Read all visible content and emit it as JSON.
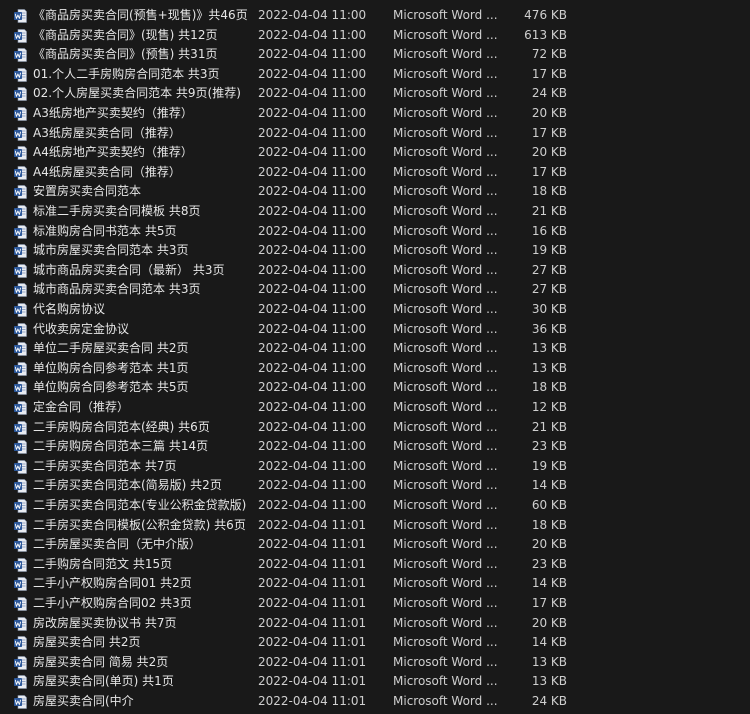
{
  "colors": {
    "background": "#191919",
    "text": "#dedede",
    "word_icon_blue": "#2b579a"
  },
  "icon": "word-document-icon",
  "files": [
    {
      "name": "《商品房买卖合同(预售+现售)》共46页",
      "modified": "2022-04-04 11:00",
      "type": "Microsoft Word ...",
      "size": "476 KB"
    },
    {
      "name": "《商品房买卖合同》(现售) 共12页",
      "modified": "2022-04-04 11:00",
      "type": "Microsoft Word ...",
      "size": "613 KB"
    },
    {
      "name": "《商品房买卖合同》(预售) 共31页",
      "modified": "2022-04-04 11:00",
      "type": "Microsoft Word ...",
      "size": "72 KB"
    },
    {
      "name": "01.个人二手房购房合同范本 共3页",
      "modified": "2022-04-04 11:00",
      "type": "Microsoft Word ...",
      "size": "17 KB"
    },
    {
      "name": "02.个人房屋买卖合同范本 共9页(推荐)",
      "modified": "2022-04-04 11:00",
      "type": "Microsoft Word ...",
      "size": "24 KB"
    },
    {
      "name": "A3纸房地产买卖契约（推荐）",
      "modified": "2022-04-04 11:00",
      "type": "Microsoft Word ...",
      "size": "20 KB"
    },
    {
      "name": "A3纸房屋买卖合同（推荐）",
      "modified": "2022-04-04 11:00",
      "type": "Microsoft Word ...",
      "size": "17 KB"
    },
    {
      "name": "A4纸房地产买卖契约（推荐）",
      "modified": "2022-04-04 11:00",
      "type": "Microsoft Word ...",
      "size": "20 KB"
    },
    {
      "name": "A4纸房屋买卖合同（推荐）",
      "modified": "2022-04-04 11:00",
      "type": "Microsoft Word ...",
      "size": "17 KB"
    },
    {
      "name": "安置房买卖合同范本",
      "modified": "2022-04-04 11:00",
      "type": "Microsoft Word ...",
      "size": "18 KB"
    },
    {
      "name": "标准二手房买卖合同模板 共8页",
      "modified": "2022-04-04 11:00",
      "type": "Microsoft Word ...",
      "size": "21 KB"
    },
    {
      "name": "标准购房合同书范本 共5页",
      "modified": "2022-04-04 11:00",
      "type": "Microsoft Word ...",
      "size": "16 KB"
    },
    {
      "name": "城市房屋买卖合同范本 共3页",
      "modified": "2022-04-04 11:00",
      "type": "Microsoft Word ...",
      "size": "19 KB"
    },
    {
      "name": "城市商品房买卖合同（最新） 共3页",
      "modified": "2022-04-04 11:00",
      "type": "Microsoft Word ...",
      "size": "27 KB"
    },
    {
      "name": "城市商品房买卖合同范本 共3页",
      "modified": "2022-04-04 11:00",
      "type": "Microsoft Word ...",
      "size": "27 KB"
    },
    {
      "name": "代名购房协议",
      "modified": "2022-04-04 11:00",
      "type": "Microsoft Word ...",
      "size": "30 KB"
    },
    {
      "name": "代收卖房定金协议",
      "modified": "2022-04-04 11:00",
      "type": "Microsoft Word ...",
      "size": "36 KB"
    },
    {
      "name": "单位二手房屋买卖合同 共2页",
      "modified": "2022-04-04 11:00",
      "type": "Microsoft Word ...",
      "size": "13 KB"
    },
    {
      "name": "单位购房合同参考范本 共1页",
      "modified": "2022-04-04 11:00",
      "type": "Microsoft Word ...",
      "size": "13 KB"
    },
    {
      "name": "单位购房合同参考范本 共5页",
      "modified": "2022-04-04 11:00",
      "type": "Microsoft Word ...",
      "size": "18 KB"
    },
    {
      "name": "定金合同（推荐）",
      "modified": "2022-04-04 11:00",
      "type": "Microsoft Word ...",
      "size": "12 KB"
    },
    {
      "name": "二手房购房合同范本(经典) 共6页",
      "modified": "2022-04-04 11:00",
      "type": "Microsoft Word ...",
      "size": "21 KB"
    },
    {
      "name": "二手房购房合同范本三篇 共14页",
      "modified": "2022-04-04 11:00",
      "type": "Microsoft Word ...",
      "size": "23 KB"
    },
    {
      "name": "二手房买卖合同范本 共7页",
      "modified": "2022-04-04 11:00",
      "type": "Microsoft Word ...",
      "size": "19 KB"
    },
    {
      "name": "二手房买卖合同范本(简易版) 共2页",
      "modified": "2022-04-04 11:00",
      "type": "Microsoft Word ...",
      "size": "14 KB"
    },
    {
      "name": "二手房买卖合同范本(专业公积金贷款版)",
      "modified": "2022-04-04 11:00",
      "type": "Microsoft Word ...",
      "size": "60 KB"
    },
    {
      "name": "二手房买卖合同模板(公积金贷款) 共6页",
      "modified": "2022-04-04 11:01",
      "type": "Microsoft Word ...",
      "size": "18 KB"
    },
    {
      "name": "二手房屋买卖合同（无中介版）",
      "modified": "2022-04-04 11:01",
      "type": "Microsoft Word ...",
      "size": "20 KB"
    },
    {
      "name": "二手购房合同范文 共15页",
      "modified": "2022-04-04 11:01",
      "type": "Microsoft Word ...",
      "size": "23 KB"
    },
    {
      "name": "二手小产权购房合同01 共2页",
      "modified": "2022-04-04 11:01",
      "type": "Microsoft Word ...",
      "size": "14 KB"
    },
    {
      "name": "二手小产权购房合同02 共3页",
      "modified": "2022-04-04 11:01",
      "type": "Microsoft Word ...",
      "size": "17 KB"
    },
    {
      "name": "房改房屋买卖协议书 共7页",
      "modified": "2022-04-04 11:01",
      "type": "Microsoft Word ...",
      "size": "20 KB"
    },
    {
      "name": "房屋买卖合同 共2页",
      "modified": "2022-04-04 11:01",
      "type": "Microsoft Word ...",
      "size": "14 KB"
    },
    {
      "name": "房屋买卖合同 简易 共2页",
      "modified": "2022-04-04 11:01",
      "type": "Microsoft Word ...",
      "size": "13 KB"
    },
    {
      "name": "房屋买卖合同(单页) 共1页",
      "modified": "2022-04-04 11:01",
      "type": "Microsoft Word ...",
      "size": "13 KB"
    },
    {
      "name": "房屋买卖合同(中介",
      "modified": "2022-04-04 11:01",
      "type": "Microsoft Word ...",
      "size": "24 KB"
    }
  ]
}
